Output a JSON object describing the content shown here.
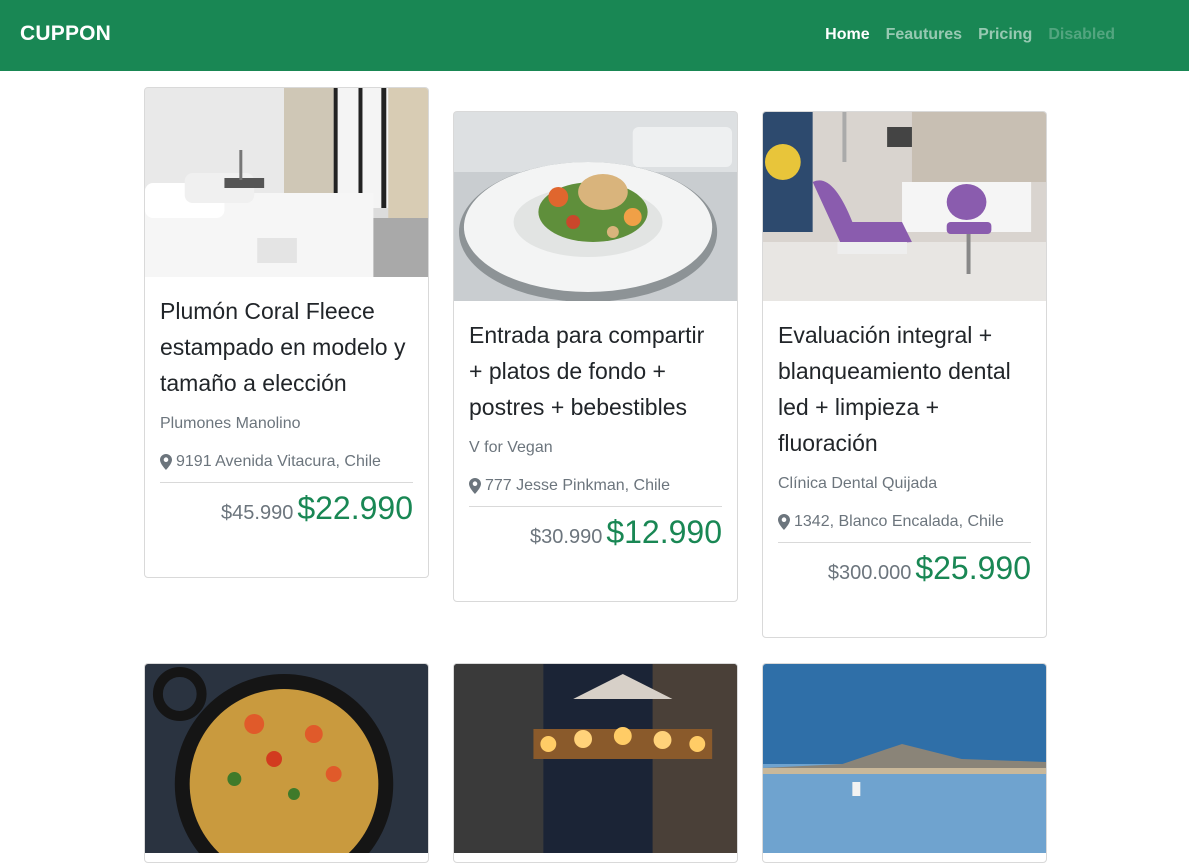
{
  "navbar": {
    "brand": "CUPPON",
    "links": [
      {
        "label": "Home"
      },
      {
        "label": "Feautures"
      },
      {
        "label": "Pricing"
      },
      {
        "label": "Disabled"
      }
    ]
  },
  "colors": {
    "brand_green": "#198754",
    "muted": "#6c757d"
  },
  "cards": [
    {
      "title": "Plumón Coral Fleece estampado en modelo y tamaño a elección",
      "vendor": "Plumones Manolino",
      "address": "9191 Avenida Vitacura, Chile",
      "old_price": "$45.990",
      "new_price": "$22.990",
      "image": "bedroom-photo"
    },
    {
      "title": "Entrada para compartir + platos de fondo + postres + bebestibles",
      "vendor": "V for Vegan",
      "address": "777 Jesse Pinkman, Chile",
      "old_price": "$30.990",
      "new_price": "$12.990",
      "image": "food-plate-photo"
    },
    {
      "title": "Evaluación integral + blanqueamiento dental led + limpieza + fluoración",
      "vendor": "Clínica Dental Quijada",
      "address": "1342, Blanco Encalada, Chile",
      "old_price": "$300.000",
      "new_price": "$25.990",
      "image": "dental-clinic-photo"
    },
    {
      "image": "pasta-pan-photo"
    },
    {
      "image": "carousel-night-photo"
    },
    {
      "image": "salt-lake-photo"
    }
  ]
}
